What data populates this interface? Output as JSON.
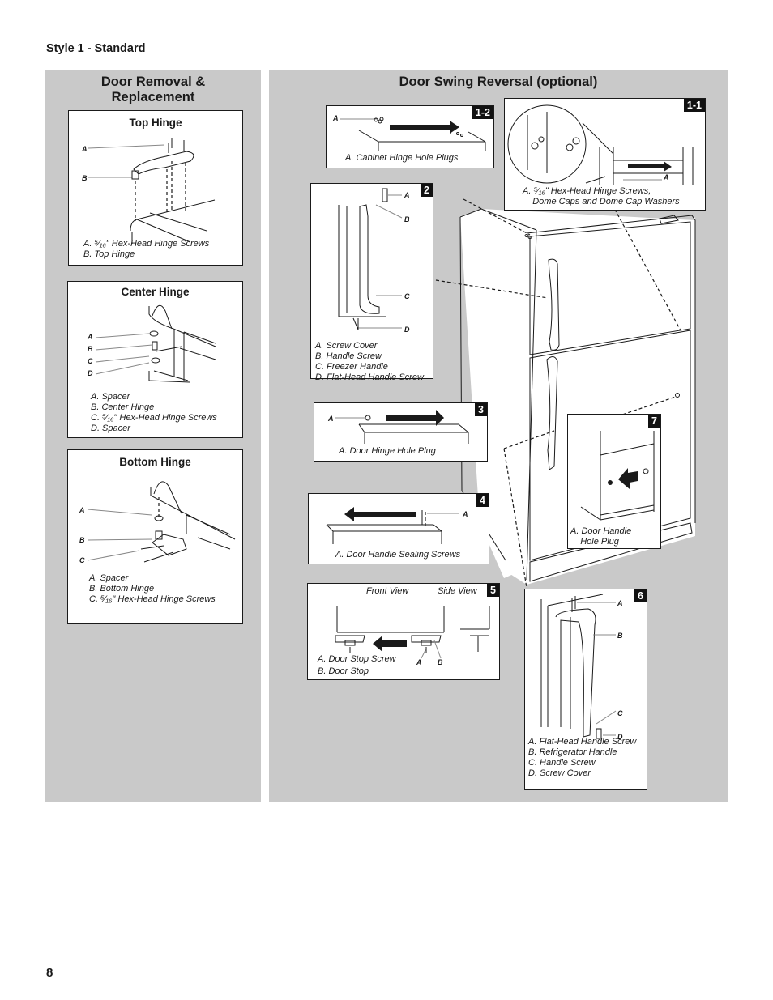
{
  "page": {
    "section_title": "Style 1 - Standard",
    "page_number": "8"
  },
  "left_panel": {
    "heading_line1": "Door Removal &",
    "heading_line2": "Replacement",
    "top_hinge": {
      "title": "Top Hinge",
      "labels": [
        "A",
        "B"
      ],
      "captions": [
        "A. ⁵⁄₁₆\" Hex-Head Hinge Screws",
        "B. Top Hinge"
      ]
    },
    "center_hinge": {
      "title": "Center Hinge",
      "labels": [
        "A",
        "B",
        "C",
        "D"
      ],
      "captions": [
        "A. Spacer",
        "B. Center Hinge",
        "C. ⁵⁄₁₆\" Hex-Head Hinge Screws",
        "D. Spacer"
      ]
    },
    "bottom_hinge": {
      "title": "Bottom Hinge",
      "labels": [
        "A",
        "B",
        "C"
      ],
      "captions": [
        "A. Spacer",
        "B. Bottom Hinge",
        "C. ⁵⁄₁₆\" Hex-Head Hinge Screws"
      ]
    }
  },
  "right_panel": {
    "heading": "Door Swing Reversal (optional)",
    "steps": {
      "s1_2": {
        "badge": "1-2",
        "labels": [
          "A"
        ],
        "captions": [
          "A. Cabinet Hinge Hole Plugs"
        ]
      },
      "s1_1": {
        "badge": "1-1",
        "labels": [
          "A"
        ],
        "captions": [
          "A. ⁵⁄₁₆\" Hex-Head Hinge Screws,",
          "    Dome Caps and Dome Cap Washers"
        ]
      },
      "s2": {
        "badge": "2",
        "labels": [
          "A",
          "B",
          "C",
          "D"
        ],
        "captions": [
          "A. Screw Cover",
          "B. Handle Screw",
          "C. Freezer Handle",
          "D. Flat-Head Handle Screw"
        ]
      },
      "s3": {
        "badge": "3",
        "labels": [
          "A"
        ],
        "captions": [
          "A. Door Hinge Hole Plug"
        ]
      },
      "s4": {
        "badge": "4",
        "labels": [
          "A"
        ],
        "captions": [
          "A. Door Handle Sealing Screws"
        ]
      },
      "s5": {
        "badge": "5",
        "view_front": "Front View",
        "view_side": "Side View",
        "labels": [
          "A",
          "B"
        ],
        "captions": [
          "A. Door Stop Screw",
          "B. Door Stop"
        ]
      },
      "s6": {
        "badge": "6",
        "labels": [
          "A",
          "B",
          "C",
          "D"
        ],
        "captions": [
          "A. Flat-Head Handle Screw",
          "B. Refrigerator Handle",
          "C. Handle Screw",
          "D. Screw Cover"
        ]
      },
      "s7": {
        "badge": "7",
        "captions": [
          "A. Door Handle",
          "    Hole Plug"
        ]
      }
    }
  }
}
